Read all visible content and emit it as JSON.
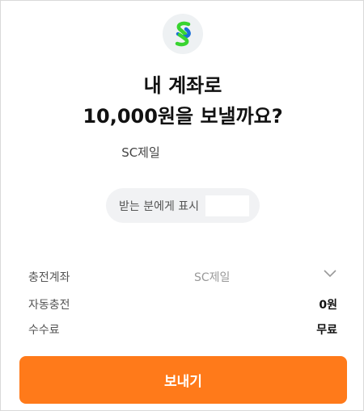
{
  "header": {
    "logo_icon": "standard-chartered-logo-icon",
    "title_line1": "내 계좌로",
    "title_line2": "10,000원을 보낼까요?"
  },
  "recipient": {
    "account_name": "SC제일"
  },
  "memo": {
    "label": "받는 분에게 표시",
    "value": ""
  },
  "details": {
    "charge_account": {
      "label": "충전계좌",
      "value": "SC제일"
    },
    "auto_charge": {
      "label": "자동충전",
      "value": "0원"
    },
    "fee": {
      "label": "수수료",
      "value": "무료"
    }
  },
  "actions": {
    "send_label": "보내기"
  },
  "colors": {
    "accent": "#ff7a1a",
    "logo_green": "#38d430",
    "logo_blue": "#1a6fd8"
  }
}
